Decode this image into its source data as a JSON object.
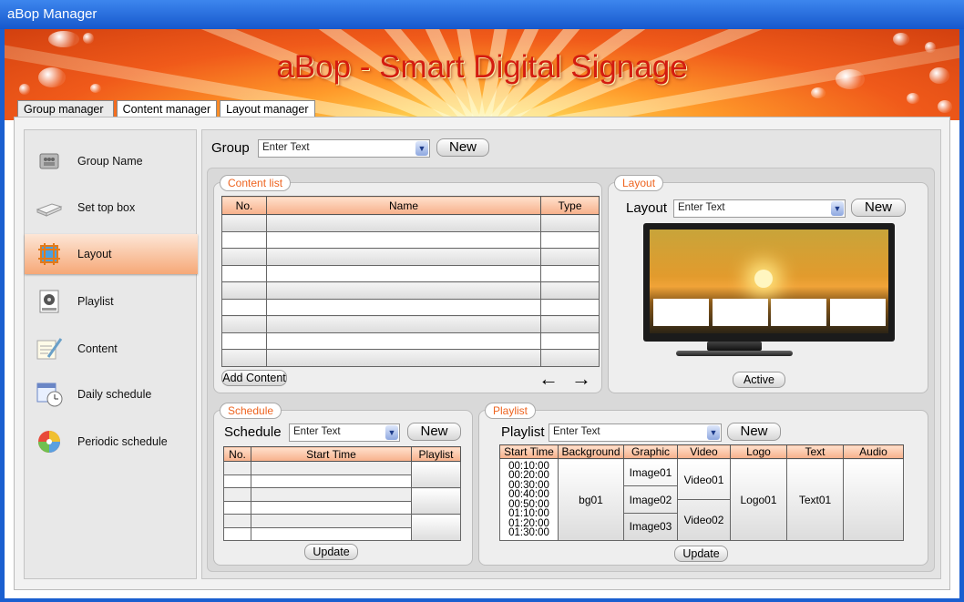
{
  "window": {
    "title": "aBop Manager"
  },
  "banner": {
    "title": "aBop - Smart Digital Signage"
  },
  "tabs": [
    {
      "label": "Group manager"
    },
    {
      "label": "Content manager"
    },
    {
      "label": "Layout manager"
    }
  ],
  "sidebar": {
    "items": [
      {
        "label": "Group Name",
        "icon": "group-icon"
      },
      {
        "label": "Set top box",
        "icon": "set-top-box-icon"
      },
      {
        "label": "Layout",
        "icon": "layout-icon"
      },
      {
        "label": "Playlist",
        "icon": "playlist-icon"
      },
      {
        "label": "Content",
        "icon": "content-icon"
      },
      {
        "label": "Daily schedule",
        "icon": "daily-schedule-icon"
      },
      {
        "label": "Periodic schedule",
        "icon": "periodic-schedule-icon"
      }
    ],
    "active": "Layout"
  },
  "group": {
    "label": "Group",
    "placeholder": "Enter Text",
    "new_label": "New"
  },
  "content_list": {
    "legend": "Content list",
    "columns": [
      "No.",
      "Name",
      "Type"
    ],
    "add_label": "Add Content",
    "prev_label": "←",
    "next_label": "→"
  },
  "layout": {
    "legend": "Layout",
    "label": "Layout",
    "placeholder": "Enter Text",
    "new_label": "New",
    "active_label": "Active"
  },
  "schedule": {
    "legend": "Schedule",
    "label": "Schedule",
    "placeholder": "Enter Text",
    "new_label": "New",
    "columns": [
      "No.",
      "Start Time",
      "Playlist"
    ],
    "update_label": "Update"
  },
  "playlist": {
    "legend": "Playlist",
    "label": "Playlist",
    "placeholder": "Enter Text",
    "new_label": "New",
    "columns": [
      "Start Time",
      "Background",
      "Graphic",
      "Video",
      "Logo",
      "Text",
      "Audio"
    ],
    "start_times": [
      "00:10:00",
      "00:20:00",
      "00:30:00",
      "00:40:00",
      "00:50:00",
      "01:10:00",
      "01:20:00",
      "01:30:00"
    ],
    "background": "bg01",
    "graphics": [
      "Image01",
      "Image02",
      "Image03"
    ],
    "videos": [
      "Video01",
      "Video02"
    ],
    "logo": "Logo01",
    "text": "Text01",
    "audio": "",
    "update_label": "Update"
  },
  "colors": {
    "accent": "#ee6420",
    "titlebar": "#1a5fd0",
    "banner_title": "#d41c10"
  }
}
